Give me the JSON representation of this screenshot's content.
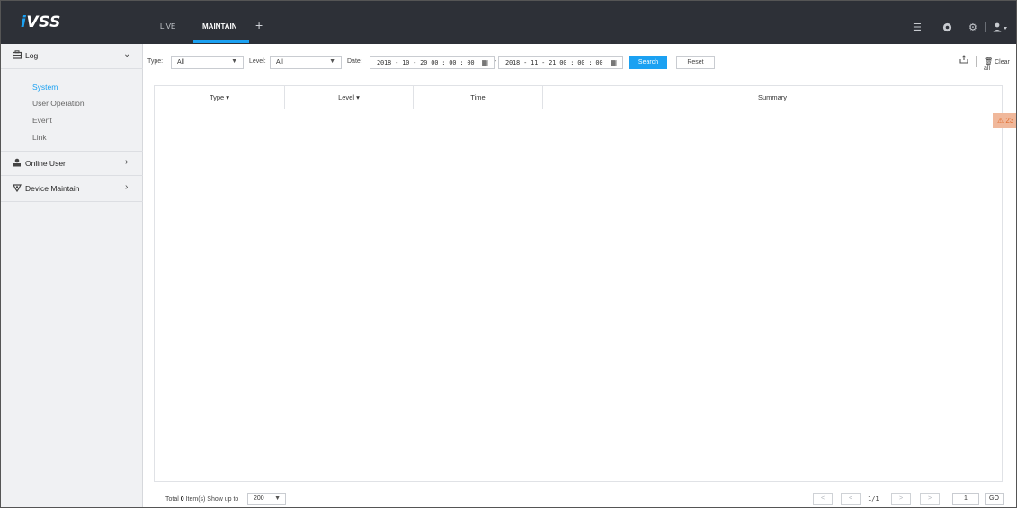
{
  "app": {
    "logo_prefix": "i",
    "logo_rest": "VSS"
  },
  "tabs": [
    {
      "label": "LIVE"
    },
    {
      "label": "MAINTAIN"
    }
  ],
  "add_tab_glyph": "+",
  "sidebar": {
    "log": {
      "label": "Log",
      "items": [
        "System",
        "User Operation",
        "Event",
        "Link"
      ],
      "active": "System"
    },
    "online_user": {
      "label": "Online User"
    },
    "device_maintain": {
      "label": "Device Maintain"
    }
  },
  "filters": {
    "type_label": "Type:",
    "type_value": "All",
    "level_label": "Level:",
    "level_value": "All",
    "date_label": "Date:",
    "date_start": "2018 - 10 - 20  00 : 00 : 00",
    "date_end": "2018 - 11 - 21  00 : 00 : 00",
    "date_sep": "-",
    "search_label": "Search",
    "reset_label": "Reset",
    "clear_all_label": "Clear all"
  },
  "table": {
    "columns": [
      "Type",
      "Level",
      "Time",
      "Summary"
    ],
    "rows": []
  },
  "alarm_badge": "23",
  "footer": {
    "total_prefix": "Total ",
    "total_count": "0",
    "total_suffix": " Item(s)  Show up to",
    "page_size": "200",
    "page_info": "1/1",
    "page_input": "1",
    "go_label": "GO"
  },
  "colors": {
    "accent": "#1ba1f2",
    "topbar": "#2d3037",
    "sidebar": "#f0f1f3",
    "alarm": "#e06b2d"
  },
  "icons": [
    "list-icon",
    "status-icon",
    "settings-icon",
    "user-icon",
    "briefcase-icon",
    "person-icon",
    "device-icon",
    "export-icon",
    "trash-icon",
    "calendar-icon",
    "warning-icon"
  ]
}
